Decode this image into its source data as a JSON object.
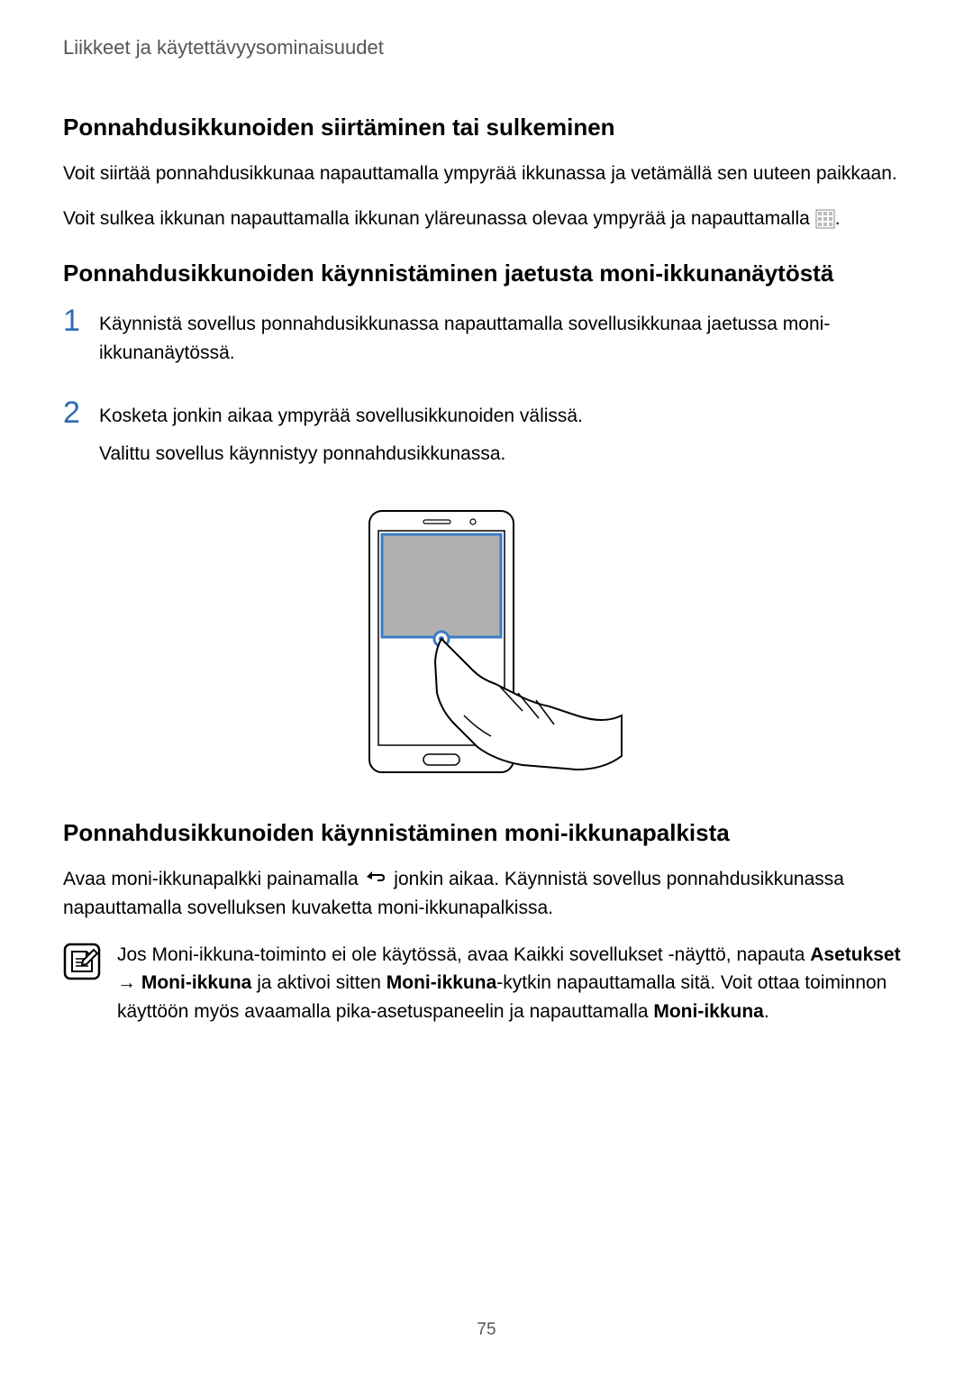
{
  "header": {
    "title": "Liikkeet ja käytettävyysominaisuudet"
  },
  "section1": {
    "heading": "Ponnahdusikkunoiden siirtäminen tai sulkeminen",
    "para1": "Voit siirtää ponnahdusikkunaa napauttamalla ympyrää ikkunassa ja vetämällä sen uuteen paikkaan.",
    "para2_before": "Voit sulkea ikkunan napauttamalla ikkunan yläreunassa olevaa ympyrää ja napauttamalla ",
    "para2_after": "."
  },
  "section2": {
    "heading": "Ponnahdusikkunoiden käynnistäminen jaetusta moni-ikkunanäytöstä",
    "step1": {
      "num": "1",
      "text": "Käynnistä sovellus ponnahdusikkunassa napauttamalla sovellusikkunaa jaetussa moni-ikkunanäytössä."
    },
    "step2": {
      "num": "2",
      "text1": "Kosketa jonkin aikaa ympyrää sovellusikkunoiden välissä.",
      "text2": "Valittu sovellus käynnistyy ponnahdusikkunassa."
    }
  },
  "section3": {
    "heading": "Ponnahdusikkunoiden käynnistäminen moni-ikkunapalkista",
    "para1_before": "Avaa moni-ikkunapalkki painamalla ",
    "para1_after": " jonkin aikaa. Käynnistä sovellus ponnahdusikkunassa napauttamalla sovelluksen kuvaketta moni-ikkunapalkissa.",
    "note": {
      "part1": "Jos Moni-ikkuna-toiminto ei ole käytössä, avaa Kaikki sovellukset -näyttö, napauta ",
      "bold1": "Asetukset",
      "arrow": " → ",
      "bold2": "Moni-ikkuna",
      "part2": " ja aktivoi sitten ",
      "bold3": "Moni-ikkuna",
      "part3": "-kytkin napauttamalla sitä. Voit ottaa toiminnon käyttöön myös avaamalla pika-asetuspaneelin ja napauttamalla ",
      "bold4": "Moni-ikkuna",
      "part4": "."
    }
  },
  "pageNumber": "75"
}
